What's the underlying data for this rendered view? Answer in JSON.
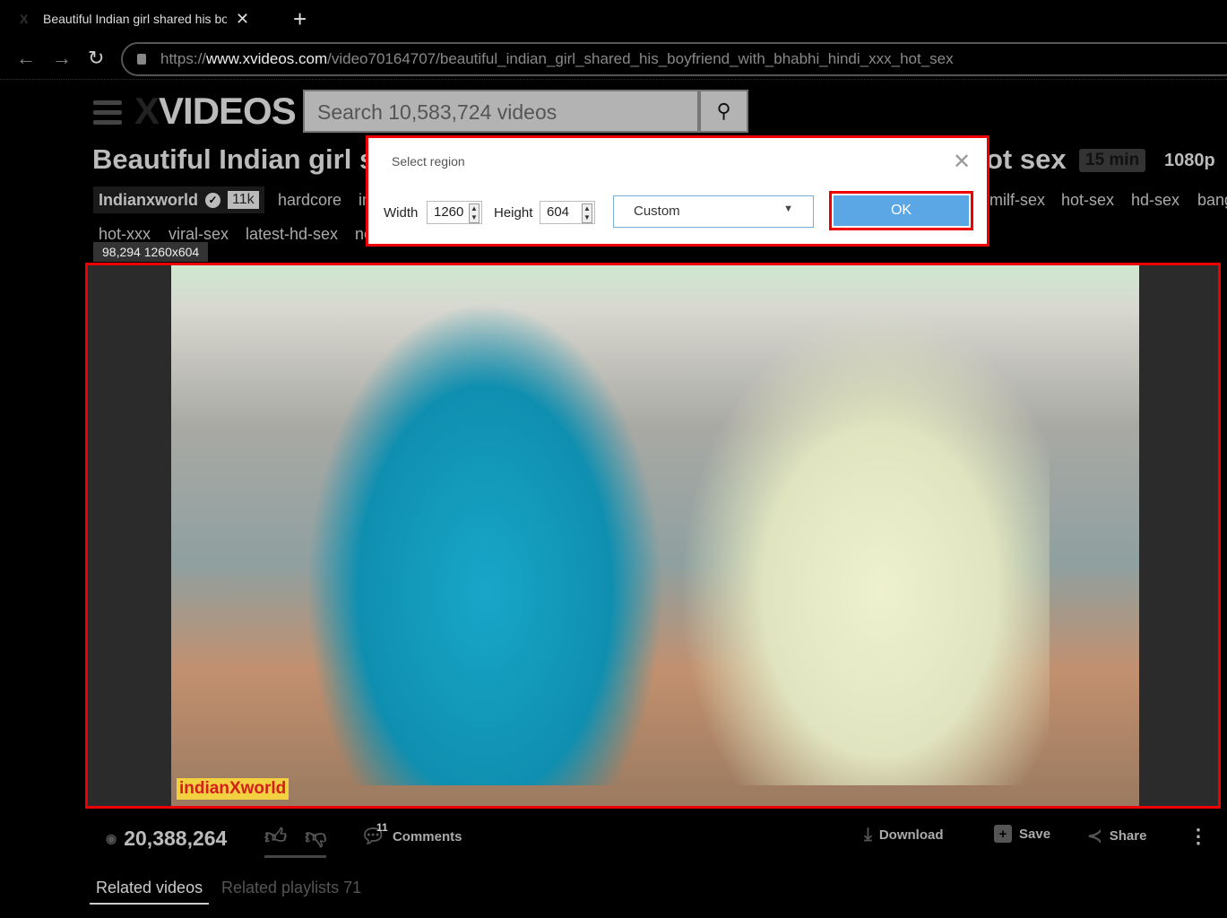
{
  "browser": {
    "tab_title": "Beautiful Indian girl shared his boyfriend",
    "url_scheme": "https://",
    "url_host": "www.xvideos.com",
    "url_path": "/video70164707/beautiful_indian_girl_shared_his_boyfriend_with_bhabhi_hindi_xxx_hot_sex"
  },
  "site": {
    "logo_x": "X",
    "logo_text": "VIDEOS",
    "search_placeholder": "Search 10,583,724 videos"
  },
  "video": {
    "title_left": "Beautiful Indian girl s",
    "title_right": "ot sex",
    "duration": "15 min",
    "quality": "1080p",
    "uploader": "Indianxworld",
    "subscribers": "11k",
    "tags_row1_left": [
      "hardcore",
      "in"
    ],
    "tags_row1_right": [
      "milf-sex",
      "hot-sex",
      "hd-sex",
      "bang"
    ],
    "tags_row2": [
      "hot-xxx",
      "viral-sex",
      "latest-hd-sex",
      "ne"
    ],
    "watermark": "indianXworld",
    "views": "20,388,264",
    "comments_count": "11",
    "comments_label": "Comments",
    "actions": [
      "Download",
      "Save",
      "Share"
    ]
  },
  "capture": {
    "overlay": "98,294 1260x604",
    "dialog_title": "Select region",
    "width_label": "Width",
    "width": "1260",
    "height_label": "Height",
    "height": "604",
    "preset": "Custom",
    "ok": "OK",
    "accent": "#5ba7e6",
    "frame_color": "#ee0000"
  },
  "tabs": {
    "related_videos": "Related videos",
    "related_playlists": "Related playlists 71"
  }
}
